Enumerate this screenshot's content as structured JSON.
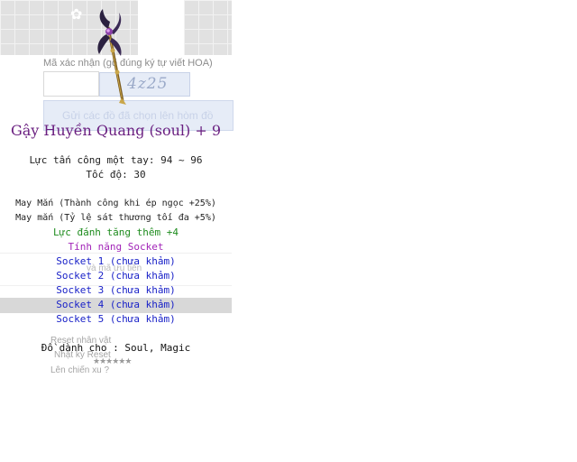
{
  "background": {
    "captcha_label": "Mã xác nhận (gõ đúng ký tự viết HOA)",
    "captcha_image_text": "4z25",
    "submit_text": "Gửi các đồ đã chọn lên hòm đồ",
    "code_note": "và mã ưu tiên",
    "reset_text": "Reset nhân vật",
    "reset_log_text": "Nhật ký Reset",
    "rating_stars": "★★★★★★",
    "more_text": "Lên chiến xu ?"
  },
  "item": {
    "icon": "staff-icon",
    "name": "Gậy Huyền Quang (soul) + 9",
    "attack": "Lực tấn công một tay: 94 ~ 96",
    "speed": "Tốc độ: 30",
    "luck_option_1": "May Mắn (Thành công khi ép ngọc +25%)",
    "luck_option_2": "May mắn (Tỷ lệ sát thương tối đa +5%)",
    "bonus": "Lực đánh tăng thêm +4",
    "socket_title": "Tính năng Socket",
    "sockets": [
      "Socket 1 (chưa khảm)",
      "Socket 2 (chưa khảm)",
      "Socket 3 (chưa khảm)",
      "Socket 4 (chưa khảm)",
      "Socket 5 (chưa khảm)"
    ],
    "for_classes": "Đồ dành cho : Soul, Magic"
  },
  "colors": {
    "item_name": "#6a1f80",
    "bonus": "#1e8c1e",
    "socket_title": "#a225b8",
    "socket": "#1a22c8",
    "highlight_row": "#d8d8d8"
  }
}
